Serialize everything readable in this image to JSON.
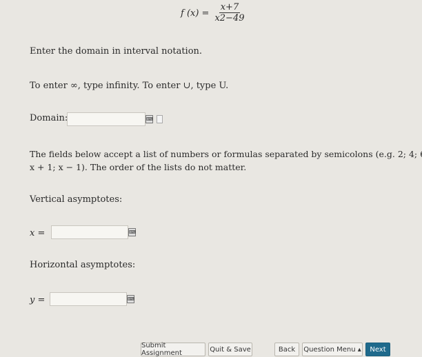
{
  "formula": {
    "lhs": "f (x) =",
    "numerator": "x+7",
    "denominator": "x2−49"
  },
  "instructions": {
    "domain_prompt": "Enter the domain in interval notation.",
    "infinity_hint": "To enter ∞, type infinity. To enter ∪, type U.",
    "list_note_line1": "The fields below accept a list of numbers or formulas separated by semicolons (e.g. 2; 4; 6 or",
    "list_note_line2": "x + 1; x − 1). The order of the lists do not matter."
  },
  "fields": {
    "domain_label": "Domain:",
    "domain_value": "",
    "vertical_heading": "Vertical asymptotes:",
    "vertical_prefix": "x =",
    "vertical_value": "",
    "horizontal_heading": "Horizontal asymptotes:",
    "horizontal_prefix": "y =",
    "horizontal_value": ""
  },
  "buttons": {
    "submit": "Submit Assignment",
    "quit": "Quit & Save",
    "back": "Back",
    "menu": "Question Menu ▴",
    "next": "Next"
  },
  "icons": {
    "keyboard": "⌨",
    "page": "page-icon"
  }
}
